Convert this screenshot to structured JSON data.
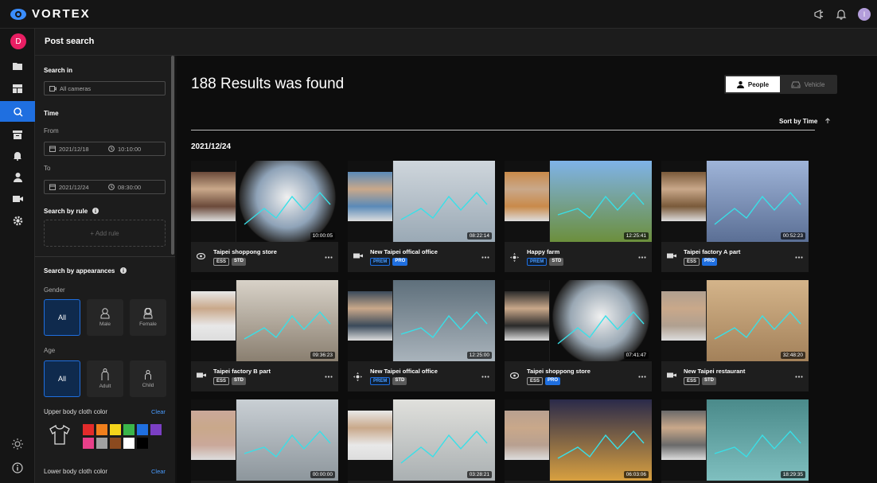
{
  "app": {
    "name": "VORTEX",
    "user_initial": "D",
    "top_user_initial": "I"
  },
  "panel": {
    "title": "Post search"
  },
  "filters": {
    "search_in_label": "Search in",
    "cameras_value": "All cameras",
    "time_label": "Time",
    "from_label": "From",
    "from_date": "2021/12/18",
    "from_time": "10:10:00",
    "to_label": "To",
    "to_date": "2021/12/24",
    "to_time": "08:30:00",
    "rule_label": "Search by rule",
    "add_rule": "+ Add rule",
    "appearance_label": "Search by appearances",
    "gender_label": "Gender",
    "gender_options": [
      "All",
      "Male",
      "Female"
    ],
    "age_label": "Age",
    "age_options": [
      "All",
      "Adult",
      "Child"
    ],
    "upper_label": "Upper body cloth color",
    "lower_label": "Lower body cloth color",
    "clear": "Clear",
    "colors": [
      "#e32b2b",
      "#f07f1c",
      "#f5d51b",
      "#3ab54a",
      "#1f6fe0",
      "#7b3fc4",
      "#e8408a",
      "#a0a0a0",
      "#8b4a1f",
      "#ffffff",
      "#000000"
    ]
  },
  "main": {
    "results_title": "188 Results was found",
    "toggle_people": "People",
    "toggle_vehicle": "Vehicle",
    "sort_label": "Sort by Time",
    "date": "2021/12/24",
    "cards": [
      {
        "name": "Taipei shoppong store",
        "duration": "10:00:05",
        "tags": [
          "ESS",
          "STD"
        ],
        "icon": "fisheye-camera-icon"
      },
      {
        "name": "New Taipei offical office",
        "duration": "08:22:14",
        "tags": [
          "PREM",
          "PRO"
        ],
        "icon": "bullet-camera-icon"
      },
      {
        "name": "Happy farm",
        "duration": "12:25:41",
        "tags": [
          "PREM",
          "STD"
        ],
        "icon": "ptz-camera-icon"
      },
      {
        "name": "Taipei factory A part",
        "duration": "00:52:23",
        "tags": [
          "ESS",
          "PRO"
        ],
        "icon": "bullet-camera-icon"
      },
      {
        "name": "Taipei factory B part",
        "duration": "09:36:23",
        "tags": [
          "ESS",
          "STD"
        ],
        "icon": "bullet-camera-icon"
      },
      {
        "name": "New Taipei offical office",
        "duration": "12:25:00",
        "tags": [
          "PREM",
          "STD"
        ],
        "icon": "ptz-camera-icon"
      },
      {
        "name": "Taipei shoppong store",
        "duration": "07:41:47",
        "tags": [
          "ESS",
          "PRO"
        ],
        "icon": "fisheye-camera-icon"
      },
      {
        "name": "New Taipei restaurant",
        "duration": "32:48:20",
        "tags": [
          "ESS",
          "STD"
        ],
        "icon": "bullet-camera-icon"
      },
      {
        "name": "",
        "duration": "00:00:00",
        "tags": [],
        "icon": ""
      },
      {
        "name": "",
        "duration": "03:28:21",
        "tags": [],
        "icon": ""
      },
      {
        "name": "",
        "duration": "06:03:06",
        "tags": [],
        "icon": ""
      },
      {
        "name": "",
        "duration": "18:29:35",
        "tags": [],
        "icon": ""
      }
    ]
  }
}
